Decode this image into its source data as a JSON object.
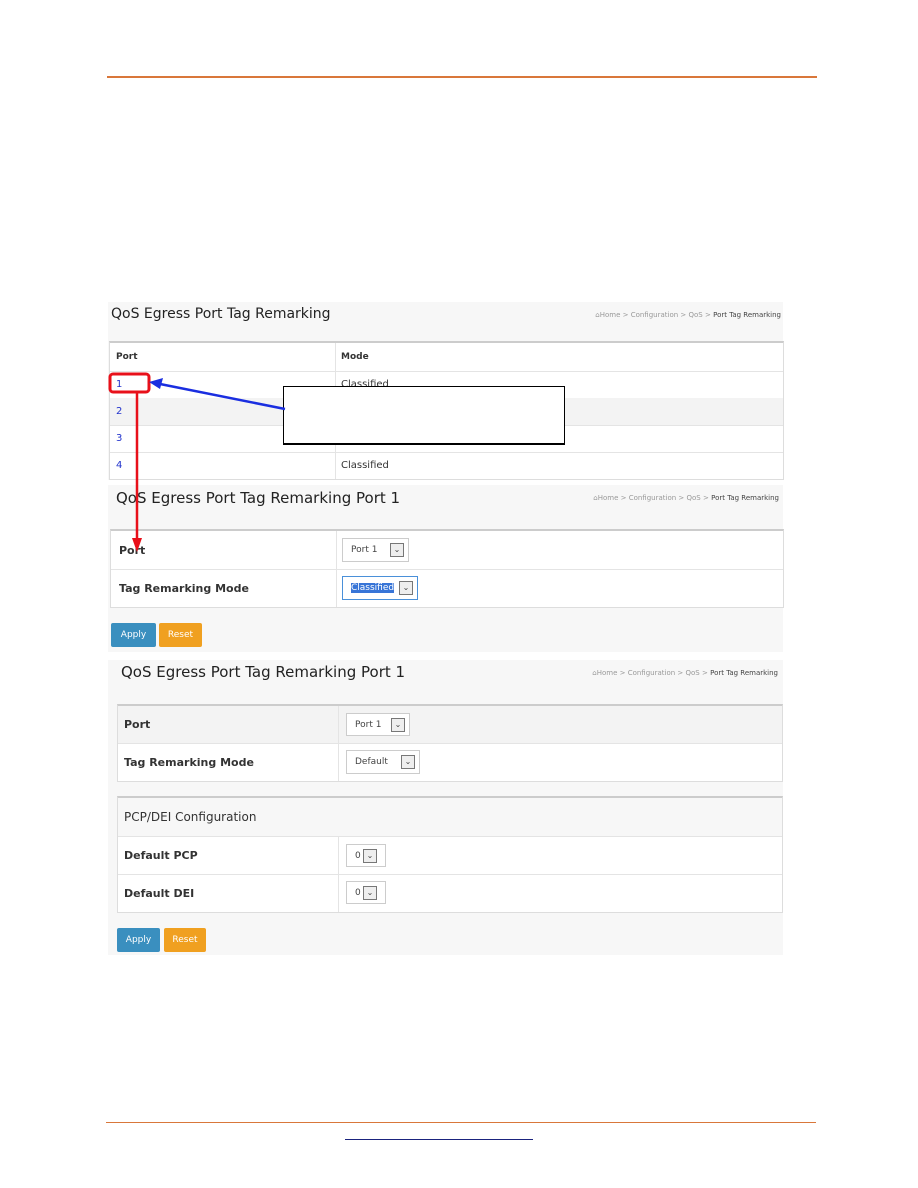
{
  "colors": {
    "rule": "#d9773a",
    "link": "#2233cc",
    "apply": "#3a8fbf",
    "reset": "#f0a020",
    "annotation_arrow_blue": "#1a2ee0",
    "annotation_red": "#e8101a"
  },
  "breadcrumb": {
    "home": "Home",
    "items": [
      "Configuration",
      "QoS",
      "Port Tag Remarking"
    ],
    "separator": ">"
  },
  "panel1": {
    "title": "QoS Egress Port Tag Remarking",
    "headers": [
      "Port",
      "Mode"
    ],
    "rows": [
      {
        "port": "1",
        "mode": "Classified"
      },
      {
        "port": "2",
        "mode": ""
      },
      {
        "port": "3",
        "mode": ""
      },
      {
        "port": "4",
        "mode": "Classified"
      }
    ]
  },
  "panel2": {
    "title": "QoS Egress Port Tag Remarking  Port 1",
    "port_label": "Port",
    "port_value": "Port 1",
    "mode_label": "Tag Remarking Mode",
    "mode_value": "Classified",
    "apply": "Apply",
    "reset": "Reset"
  },
  "panel3": {
    "title": "QoS Egress Port Tag Remarking  Port 1",
    "port_label": "Port",
    "port_value": "Port 1",
    "mode_label": "Tag Remarking Mode",
    "mode_value": "Default",
    "section": "PCP/DEI Configuration",
    "pcp_label": "Default PCP",
    "pcp_value": "0",
    "dei_label": "Default DEI",
    "dei_value": "0",
    "apply": "Apply",
    "reset": "Reset"
  }
}
